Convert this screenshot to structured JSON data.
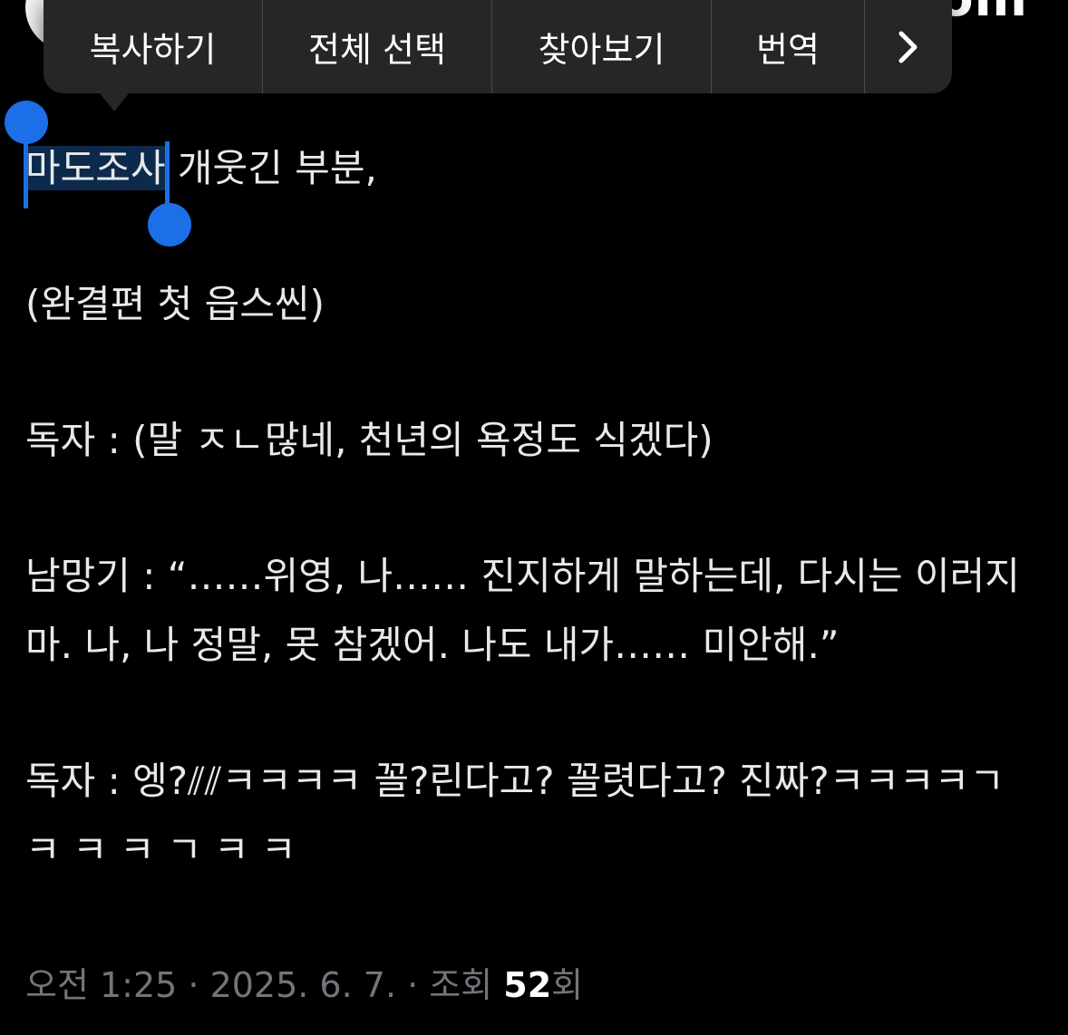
{
  "header": {
    "top_right_fragment": "om"
  },
  "context_menu": {
    "items": [
      {
        "label": "복사하기"
      },
      {
        "label": "전체 선택"
      },
      {
        "label": "찾아보기"
      },
      {
        "label": "번역"
      }
    ],
    "more_icon": "chevron-right-icon"
  },
  "post": {
    "selected_text": "마도조사",
    "line1_rest": " 개웃긴 부분,",
    "line2": "(완결편 첫 읍스씬)",
    "line3": "독자 : (말 ㅈㄴ많네, 천년의 욕정도 식겠다)",
    "line4": "남망기 : “……위영, 나…… 진지하게 말하는데, 다시는 이러지 마. 나, 나 정말, 못 참겠어. 나도 내가…… 미안해.”",
    "line5": "독자 : 엥?⫽⫽ㅋㅋㅋㅋ 꼴?린다고? 꼴렷다고? 진짜?ㅋㅋㅋㅋㄱ ㅋ ㅋ ㅋ ㄱ ㅋ ㅋ"
  },
  "meta": {
    "time_date": "오전 1:25 · 2025. 6. 7. · 조회 ",
    "views_count": "52",
    "views_suffix": "회"
  },
  "colors": {
    "background": "#000000",
    "text": "#e7e9ea",
    "meta_text": "#71767b",
    "selection_highlight": "#0d2a4d",
    "selection_handle": "#1d6fe8",
    "menu_background": "#262628"
  }
}
